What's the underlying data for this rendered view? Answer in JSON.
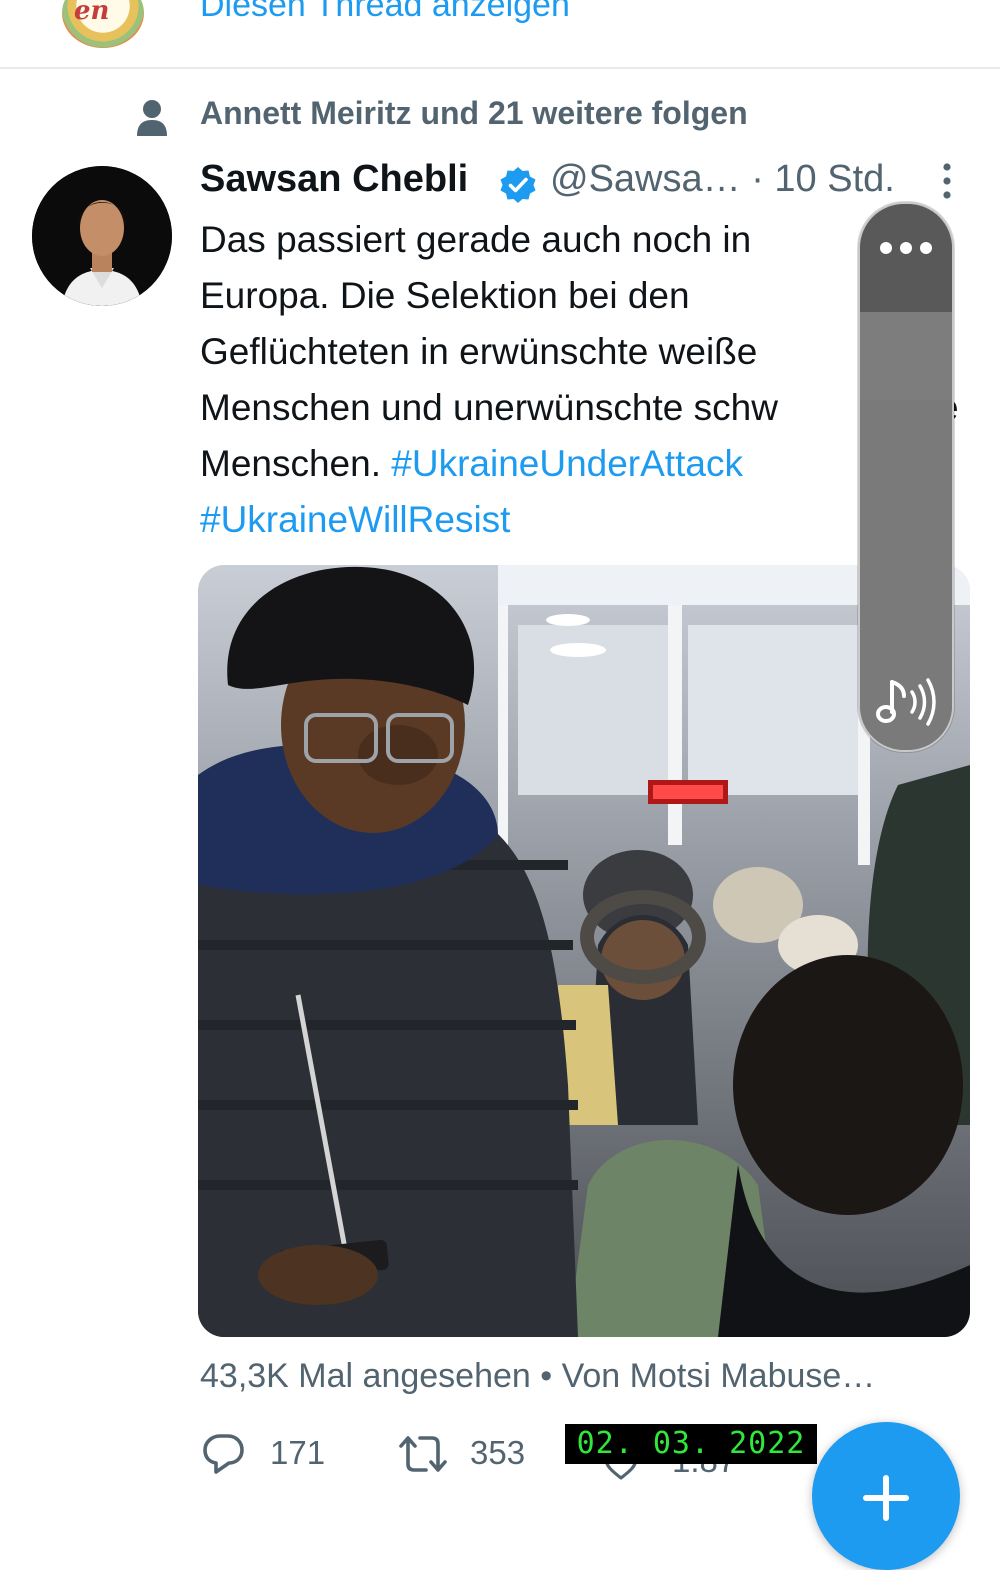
{
  "thread": {
    "show_thread_label": "Diesen Thread anzeigen",
    "avatar_text": "en"
  },
  "social_context": {
    "text": "Annett Meiritz und 21 weitere folgen"
  },
  "tweet": {
    "author_name": "Sawsan Chebli",
    "handle_time": "@Sawsa… · 10 Std.",
    "text_main": "Das passiert gerade auch noch in Europa. Die Selektion bei den Geflüchteten in erwünschte weiße Menschen und unerwünschte  schw",
    "text_overflow_fragment": "e",
    "text_tail": "Menschen.",
    "hashtag_1": "#UkraineUnderAttack",
    "hashtag_2": "#UkraineWillResist",
    "media_type": "video",
    "views_line": "43,3K Mal angesehen • Von Motsi Mabuse…",
    "reply_count": "171",
    "retweet_count": "353",
    "like_count": "1.87"
  },
  "overlay": {
    "date_stamp": "02. 03. 2022",
    "volume_level": 0.8
  },
  "icons": {
    "person": "person-icon",
    "verified": "verified-badge-icon",
    "more": "more-vertical-icon",
    "reply": "reply-icon",
    "retweet": "retweet-icon",
    "like": "heart-icon",
    "compose": "plus-icon",
    "volume_menu": "more-horizontal-icon",
    "volume": "music-volume-icon"
  },
  "colors": {
    "accent": "#1d9bf0",
    "secondary_text": "#536471",
    "date_stamp_text": "#31e83a"
  }
}
